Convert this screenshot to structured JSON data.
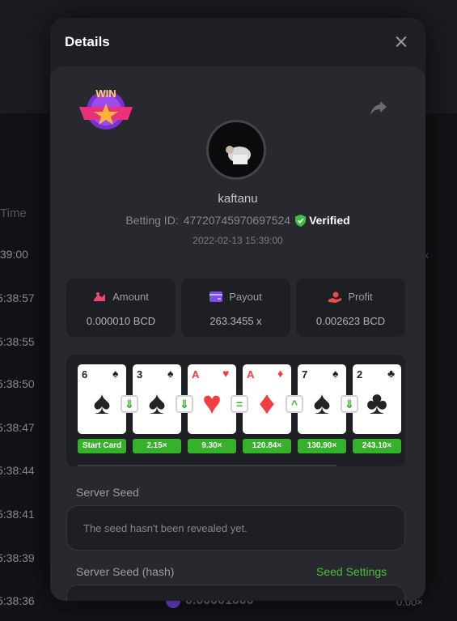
{
  "background": {
    "column_header": "Time",
    "times": [
      ":39:00",
      "5:38:57",
      "5:38:55",
      "5:38:50",
      "5:38:47",
      "5:38:44",
      "5:38:41",
      "5:38:39",
      "5:38:36"
    ],
    "right_values": [
      "x",
      "0.00×"
    ],
    "bottom_amount": "0.00001000"
  },
  "modal": {
    "title": "Details",
    "badge_text": "WIN",
    "username": "kaftanu",
    "betting_id_label": "Betting ID:",
    "betting_id": "47720745970697524",
    "verified_label": "Verified",
    "date": "2022-02-13 15:39:00",
    "stats": [
      {
        "label": "Amount",
        "value": "0.000010 BCD"
      },
      {
        "label": "Payout",
        "value": "263.3455 x"
      },
      {
        "label": "Profit",
        "value": "0.002623 BCD"
      }
    ],
    "cards": [
      {
        "rank": "6",
        "suit": "♠",
        "color": "black",
        "multiplier": "Start Card"
      },
      {
        "rank": "3",
        "suit": "♠",
        "color": "black",
        "multiplier": "2.15×"
      },
      {
        "rank": "A",
        "suit": "♥",
        "color": "red",
        "multiplier": "9.30×"
      },
      {
        "rank": "A",
        "suit": "♦",
        "color": "red",
        "multiplier": "120.84×"
      },
      {
        "rank": "7",
        "suit": "♠",
        "color": "black",
        "multiplier": "130.90×"
      },
      {
        "rank": "2",
        "suit": "♣",
        "color": "black",
        "multiplier": "243.10×"
      }
    ],
    "guesses": [
      "⇓",
      "⇓",
      "=",
      "^",
      "⇓"
    ],
    "server_seed_label": "Server Seed",
    "server_seed_placeholder": "The seed hasn't been revealed yet.",
    "server_seed_hash_label": "Server Seed (hash)",
    "seed_settings_label": "Seed Settings"
  },
  "colors": {
    "accent_green": "#4fbf34",
    "multiplier_green": "#35b12b",
    "amount_icon": "#f2466d",
    "payout_icon": "#7b4dea",
    "profit_icon": "#ef4b4b"
  }
}
